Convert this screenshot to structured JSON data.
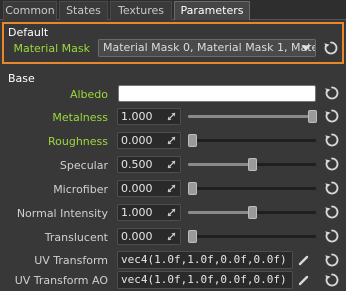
{
  "tabs": [
    {
      "label": "Common",
      "active": false
    },
    {
      "label": "States",
      "active": false
    },
    {
      "label": "Textures",
      "active": false
    },
    {
      "label": "Parameters",
      "active": true
    }
  ],
  "default_section": {
    "title": "Default",
    "material_mask_label": "Material Mask",
    "material_mask_value": "Material Mask 0, Material Mask 1, Mate..."
  },
  "base_section": {
    "title": "Base",
    "albedo_label": "Albedo",
    "albedo_color": "#ffffff",
    "metalness": {
      "label": "Metalness",
      "value": "1.000",
      "fraction": 1.0
    },
    "roughness": {
      "label": "Roughness",
      "value": "0.000",
      "fraction": 0.0
    },
    "specular": {
      "label": "Specular",
      "value": "0.500",
      "fraction": 0.5
    },
    "microfiber": {
      "label": "Microfiber",
      "value": "0.000",
      "fraction": 0.0
    },
    "normal_intensity": {
      "label": "Normal Intensity",
      "value": "1.000",
      "fraction": 0.5
    },
    "translucent": {
      "label": "Translucent",
      "value": "0.000",
      "fraction": 0.0
    },
    "uv_transform": {
      "label": "UV Transform",
      "value": "vec4(1.0f,1.0f,0.0f,0.0f)"
    },
    "uv_transform_ao": {
      "label": "UV Transform AO",
      "value": "vec4(1.0f,1.0f,0.0f,0.0f)"
    }
  },
  "colors": {
    "highlight_border": "#e8882a",
    "modified_label": "#9bd93a",
    "background": "#383838"
  },
  "icons": {
    "reset": "reset-icon",
    "dropdown": "chevron-down-icon",
    "drag": "drag-arrows-icon",
    "edit": "pencil-icon"
  }
}
